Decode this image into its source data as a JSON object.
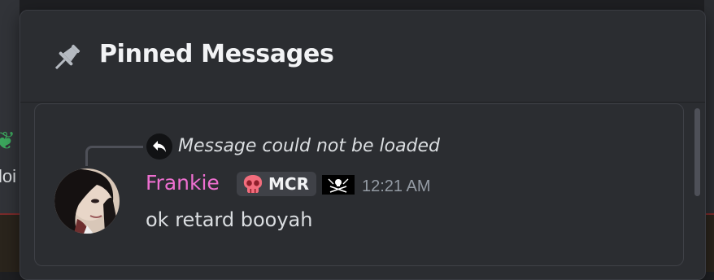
{
  "popout": {
    "title": "Pinned Messages",
    "header_icon": "pin-icon"
  },
  "background": {
    "partial_text": "loi",
    "partial_icon": "heart-reaction-icon"
  },
  "message": {
    "reply_status": "Message could not be loaded",
    "reply_icon": "reply-arrow-icon",
    "author": "Frankie",
    "author_color": "#ee6fd0",
    "role_tag": "MCR",
    "role_tag_icon": "skull-icon",
    "flag_icon": "pirate-flag-icon",
    "timestamp": "12:21 AM",
    "content": "ok retard booyah"
  },
  "colors": {
    "panel_bg": "#2b2d31",
    "card_border": "#3f4147",
    "text_primary": "#dbdee1",
    "text_muted": "#949ba4"
  }
}
